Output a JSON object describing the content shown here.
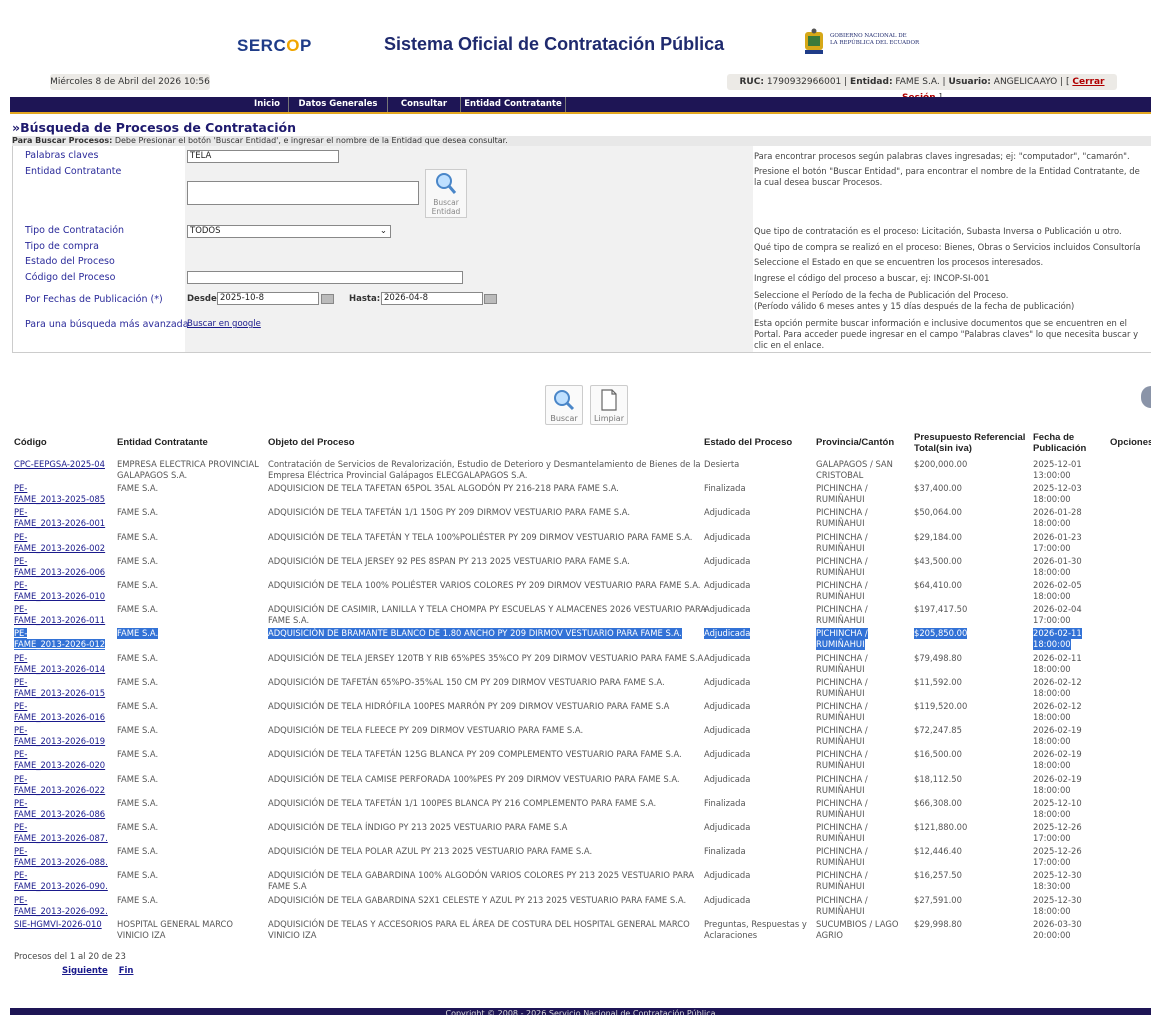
{
  "header": {
    "logo": "SERCOP",
    "system_title": "Sistema Oficial de Contratación Pública",
    "gov_line1": "GOBIERNO NACIONAL DE",
    "gov_line2": "LA REPÚBLICA DEL ECUADOR",
    "date": "Miércoles 8 de Abril del 2026 10:56",
    "ruc_label": "RUC:",
    "ruc_value": "1790932966001",
    "entidad_label": "Entidad:",
    "entidad_value": "FAME S.A.",
    "usuario_label": "Usuario:",
    "usuario_value": "ANGELICAAYO",
    "logout": "Cerrar Sesión"
  },
  "nav": [
    "Inicio",
    "Datos Generales",
    "Consultar",
    "Entidad Contratante"
  ],
  "section_title": "»Búsqueda de Procesos de Contratación",
  "instructions_bold": "Para Buscar Procesos:",
  "instructions": "Debe Presionar el botón 'Buscar Entidad', e ingresar el nombre de la Entidad que desea consultar.",
  "form": {
    "keywords_label": "Palabras claves",
    "keywords_value": "TELA",
    "keywords_help": "Para encontrar procesos según palabras claves ingresadas; ej: \"computador\", \"camarón\".",
    "entity_label": "Entidad Contratante",
    "entity_help": "Presione el botón \"Buscar Entidad\", para encontrar el nombre de la Entidad Contratante, de la cual desea buscar Procesos.",
    "search_entity_btn_1": "Buscar",
    "search_entity_btn_2": "Entidad",
    "type_label": "Tipo de Contratación",
    "type_value": "TODOS",
    "type_help": "Que tipo de contratación es el proceso: Licitación, Subasta Inversa o Publicación u otro.",
    "purchase_label": "Tipo de compra",
    "purchase_help": "Qué tipo de compra se realizó en el proceso: Bienes, Obras o Servicios incluidos Consultoría",
    "state_label": "Estado del Proceso",
    "state_help": "Seleccione el Estado en que se encuentren los procesos interesados.",
    "code_label": "Código del Proceso",
    "code_value": "",
    "code_help": "Ingrese el código del proceso a buscar, ej: INCOP-SI-001",
    "dates_label": "Por Fechas de Publicación (*)",
    "from_label": "Desde:",
    "from_value": "2025-10-8",
    "to_label": "Hasta:",
    "to_value": "2026-04-8",
    "dates_help_1": "Seleccione el Período de la fecha de Publicación del Proceso.",
    "dates_help_2": "(Período válido 6 meses antes y 15 días después de la fecha de publicación)",
    "advanced_label": "Para una búsqueda más avanzada",
    "advanced_link": "Buscar en google",
    "advanced_help": "Esta opción permite buscar información e inclusive documentos que se encuentren en el Portal. Para acceder puede ingresar en el campo \"Palabras claves\" lo que necesita buscar y clic en el enlace."
  },
  "buttons": {
    "search": "Buscar",
    "clear": "Limpiar"
  },
  "table": {
    "headers": [
      "Código",
      "Entidad Contratante",
      "Objeto del Proceso",
      "Estado del Proceso",
      "Provincia/Cantón",
      "Presupuesto Referencial Total(sin iva)",
      "Fecha de Publicación",
      "Opciones"
    ],
    "rows": [
      {
        "code1": "CPC-EEPGSA-2025-04",
        "code2": "",
        "entity1": "EMPRESA ELECTRICA PROVINCIAL",
        "entity2": "GALAPAGOS S.A.",
        "obj1": "Contratación de Servicios de Revalorización, Estudio de Deterioro y Desmantelamiento de Bienes de la",
        "obj2": "Empresa Eléctrica Provincial Galápagos ELECGALAPAGOS S.A.",
        "state1": "Desierta",
        "state2": "",
        "prov1": "GALAPAGOS / SAN",
        "prov2": "CRISTOBAL",
        "budget": "$200,000.00",
        "date1": "2025-12-01",
        "date2": "13:00:00"
      },
      {
        "code1": "PE-",
        "code2": "FAME_2013-2025-085",
        "entity1": "FAME S.A.",
        "entity2": "",
        "obj1": "ADQUISICION DE TELA TAFETAN 65POL 35AL ALGODÓN PY 216-218 PARA FAME S.A.",
        "obj2": "",
        "state1": "Finalizada",
        "state2": "",
        "prov1": "PICHINCHA /",
        "prov2": "RUMIÑAHUI",
        "budget": "$37,400.00",
        "date1": "2025-12-03",
        "date2": "18:00:00"
      },
      {
        "code1": "PE-",
        "code2": "FAME_2013-2026-001",
        "entity1": "FAME S.A.",
        "entity2": "",
        "obj1": "ADQUISICIÓN DE TELA TAFETÁN 1/1 150G PY 209 DIRMOV VESTUARIO PARA FAME S.A.",
        "obj2": "",
        "state1": "Adjudicada",
        "state2": "",
        "prov1": "PICHINCHA /",
        "prov2": "RUMIÑAHUI",
        "budget": "$50,064.00",
        "date1": "2026-01-28",
        "date2": "18:00:00"
      },
      {
        "code1": "PE-",
        "code2": "FAME_2013-2026-002",
        "entity1": "FAME S.A.",
        "entity2": "",
        "obj1": "ADQUISICIÓN DE TELA TAFETÁN Y TELA 100%POLIÉSTER PY 209 DIRMOV VESTUARIO PARA FAME S.A.",
        "obj2": "",
        "state1": "Adjudicada",
        "state2": "",
        "prov1": "PICHINCHA /",
        "prov2": "RUMIÑAHUI",
        "budget": "$29,184.00",
        "date1": "2026-01-23",
        "date2": "17:00:00"
      },
      {
        "code1": "PE-",
        "code2": "FAME_2013-2026-006",
        "entity1": "FAME S.A.",
        "entity2": "",
        "obj1": "ADQUISICIÓN DE TELA JERSEY 92 PES 8SPAN PY 213 2025 VESTUARIO PARA FAME S.A.",
        "obj2": "",
        "state1": "Adjudicada",
        "state2": "",
        "prov1": "PICHINCHA /",
        "prov2": "RUMIÑAHUI",
        "budget": "$43,500.00",
        "date1": "2026-01-30",
        "date2": "18:00:00"
      },
      {
        "code1": "PE-",
        "code2": "FAME_2013-2026-010",
        "entity1": "FAME S.A.",
        "entity2": "",
        "obj1": "ADQUISICIÓN DE TELA 100% POLIÉSTER VARIOS COLORES PY 209 DIRMOV VESTUARIO PARA FAME S.A.",
        "obj2": "",
        "state1": "Adjudicada",
        "state2": "",
        "prov1": "PICHINCHA /",
        "prov2": "RUMIÑAHUI",
        "budget": "$64,410.00",
        "date1": "2026-02-05",
        "date2": "18:00:00"
      },
      {
        "code1": "PE-",
        "code2": "FAME_2013-2026-011",
        "entity1": "FAME S.A.",
        "entity2": "",
        "obj1": "ADQUISICIÓN DE CASIMIR, LANILLA Y TELA CHOMPA PY ESCUELAS Y ALMACENES 2026 VESTUARIO PARA",
        "obj2": "FAME S.A.",
        "state1": "Adjudicada",
        "state2": "",
        "prov1": "PICHINCHA /",
        "prov2": "RUMIÑAHUI",
        "budget": "$197,417.50",
        "date1": "2026-02-04",
        "date2": "17:00:00"
      },
      {
        "code1": "PE-",
        "code2": "FAME_2013-2026-012",
        "entity1": "FAME S.A.",
        "entity2": "",
        "obj1": "ADQUISICIÓN DE BRAMANTE BLANCO DE 1.80 ANCHO PY 209 DIRMOV VESTUARIO PARA FAME S.A.",
        "obj2": "",
        "state1": "Adjudicada",
        "state2": "",
        "prov1": "PICHINCHA /",
        "prov2": "RUMIÑAHUI",
        "budget": "$205,850.00",
        "date1": "2026-02-11",
        "date2": "18:00:00",
        "selected": true
      },
      {
        "code1": "PE-",
        "code2": "FAME_2013-2026-014",
        "entity1": "FAME S.A.",
        "entity2": "",
        "obj1": "ADQUISICIÓN DE TELA JERSEY 120TB Y RIB 65%PES 35%CO PY 209 DIRMOV VESTUARIO PARA FAME S.A",
        "obj2": "",
        "state1": "Adjudicada",
        "state2": "",
        "prov1": "PICHINCHA /",
        "prov2": "RUMIÑAHUI",
        "budget": "$79,498.80",
        "date1": "2026-02-11",
        "date2": "18:00:00"
      },
      {
        "code1": "PE-",
        "code2": "FAME_2013-2026-015",
        "entity1": "FAME S.A.",
        "entity2": "",
        "obj1": "ADQUISICIÓN DE TAFETÁN 65%PO-35%AL 150 CM PY 209 DIRMOV VESTUARIO PARA FAME S.A.",
        "obj2": "",
        "state1": "Adjudicada",
        "state2": "",
        "prov1": "PICHINCHA /",
        "prov2": "RUMIÑAHUI",
        "budget": "$11,592.00",
        "date1": "2026-02-12",
        "date2": "18:00:00"
      },
      {
        "code1": "PE-",
        "code2": "FAME_2013-2026-016",
        "entity1": "FAME S.A.",
        "entity2": "",
        "obj1": "ADQUISICIÓN DE TELA HIDRÓFILA 100PES MARRÓN PY 209 DIRMOV VESTUARIO PARA FAME S.A",
        "obj2": "",
        "state1": "Adjudicada",
        "state2": "",
        "prov1": "PICHINCHA /",
        "prov2": "RUMIÑAHUI",
        "budget": "$119,520.00",
        "date1": "2026-02-12",
        "date2": "18:00:00"
      },
      {
        "code1": "PE-",
        "code2": "FAME_2013-2026-019",
        "entity1": "FAME S.A.",
        "entity2": "",
        "obj1": "ADQUISICIÓN DE TELA FLEECE PY 209 DIRMOV VESTUARIO PARA FAME S.A.",
        "obj2": "",
        "state1": "Adjudicada",
        "state2": "",
        "prov1": "PICHINCHA /",
        "prov2": "RUMIÑAHUI",
        "budget": "$72,247.85",
        "date1": "2026-02-19",
        "date2": "18:00:00"
      },
      {
        "code1": "PE-",
        "code2": "FAME_2013-2026-020",
        "entity1": "FAME S.A.",
        "entity2": "",
        "obj1": "ADQUISICIÓN DE TELA TAFETÁN 125G BLANCA PY 209 COMPLEMENTO VESTUARIO PARA FAME S.A.",
        "obj2": "",
        "state1": "Adjudicada",
        "state2": "",
        "prov1": "PICHINCHA /",
        "prov2": "RUMIÑAHUI",
        "budget": "$16,500.00",
        "date1": "2026-02-19",
        "date2": "18:00:00"
      },
      {
        "code1": "PE-",
        "code2": "FAME_2013-2026-022",
        "entity1": "FAME S.A.",
        "entity2": "",
        "obj1": "ADQUISICIÓN DE TELA CAMISE PERFORADA 100%PES PY 209 DIRMOV VESTUARIO PARA FAME S.A.",
        "obj2": "",
        "state1": "Adjudicada",
        "state2": "",
        "prov1": "PICHINCHA /",
        "prov2": "RUMIÑAHUI",
        "budget": "$18,112.50",
        "date1": "2026-02-19",
        "date2": "18:00:00"
      },
      {
        "code1": "PE-",
        "code2": "FAME_2013-2026-086",
        "entity1": "FAME S.A.",
        "entity2": "",
        "obj1": "ADQUISICIÓN DE TELA TAFETÁN 1/1 100PES BLANCA PY 216 COMPLEMENTO PARA FAME S.A.",
        "obj2": "",
        "state1": "Finalizada",
        "state2": "",
        "prov1": "PICHINCHA /",
        "prov2": "RUMIÑAHUI",
        "budget": "$66,308.00",
        "date1": "2025-12-10",
        "date2": "18:00:00"
      },
      {
        "code1": "PE-",
        "code2": "FAME_2013-2026-087.",
        "entity1": "FAME S.A.",
        "entity2": "",
        "obj1": "ADQUISICIÓN DE TELA ÍNDIGO PY 213 2025 VESTUARIO PARA FAME S.A",
        "obj2": "",
        "state1": "Adjudicada",
        "state2": "",
        "prov1": "PICHINCHA /",
        "prov2": "RUMIÑAHUI",
        "budget": "$121,880.00",
        "date1": "2025-12-26",
        "date2": "17:00:00"
      },
      {
        "code1": "PE-",
        "code2": "FAME_2013-2026-088.",
        "entity1": "FAME S.A.",
        "entity2": "",
        "obj1": "ADQUISICIÓN DE TELA POLAR AZUL PY 213 2025 VESTUARIO PARA FAME S.A.",
        "obj2": "",
        "state1": "Finalizada",
        "state2": "",
        "prov1": "PICHINCHA /",
        "prov2": "RUMIÑAHUI",
        "budget": "$12,446.40",
        "date1": "2025-12-26",
        "date2": "17:00:00"
      },
      {
        "code1": "PE-",
        "code2": "FAME_2013-2026-090.",
        "entity1": "FAME S.A.",
        "entity2": "",
        "obj1": "ADQUISICIÓN DE TELA GABARDINA 100% ALGODÓN VARIOS COLORES PY 213 2025 VESTUARIO PARA",
        "obj2": "FAME S.A",
        "state1": "Adjudicada",
        "state2": "",
        "prov1": "PICHINCHA /",
        "prov2": "RUMIÑAHUI",
        "budget": "$16,257.50",
        "date1": "2025-12-30",
        "date2": "18:30:00"
      },
      {
        "code1": "PE-",
        "code2": "FAME_2013-2026-092.",
        "entity1": "FAME S.A.",
        "entity2": "",
        "obj1": "ADQUISICIÓN DE TELA GABARDINA S2X1 CELESTE Y AZUL PY 213 2025 VESTUARIO PARA FAME S.A.",
        "obj2": "",
        "state1": "Adjudicada",
        "state2": "",
        "prov1": "PICHINCHA /",
        "prov2": "RUMIÑAHUI",
        "budget": "$27,591.00",
        "date1": "2025-12-30",
        "date2": "18:00:00"
      },
      {
        "code1": "SIE-HGMVI-2026-010",
        "code2": "",
        "entity1": "HOSPITAL GENERAL MARCO",
        "entity2": "VINICIO IZA",
        "obj1": "ADQUISICIÓN DE TELAS Y ACCESORIOS PARA EL ÁREA DE COSTURA DEL HOSPITAL GENERAL MARCO",
        "obj2": "VINICIO IZA",
        "state1": "Preguntas, Respuestas y",
        "state2": "Aclaraciones",
        "prov1": "SUCUMBIOS / LAGO",
        "prov2": "AGRIO",
        "budget": "$29,998.80",
        "date1": "2026-03-30",
        "date2": "20:00:00"
      }
    ]
  },
  "pagination": {
    "info": "Procesos del 1 al 20 de 23",
    "next": "Siguiente",
    "last": "Fin"
  },
  "footer": "Copyright © 2008 - 2026 Servicio Nacional de Contratación Pública"
}
